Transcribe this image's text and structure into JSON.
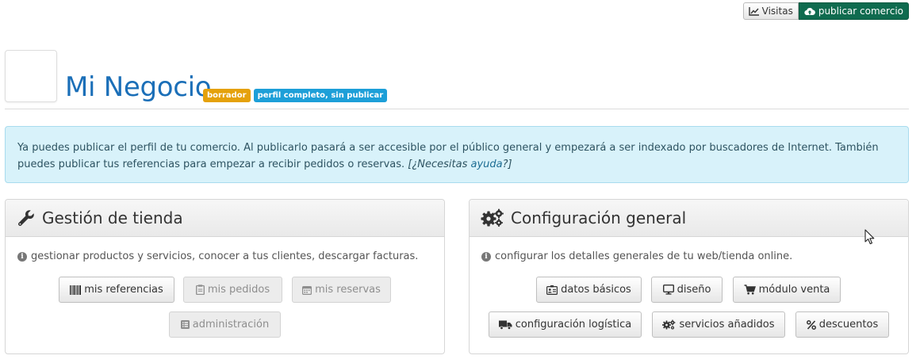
{
  "top_actions": {
    "visits_label": "Visitas",
    "publish_label": "publicar comercio",
    "publish_color": "#0f6b4f"
  },
  "header": {
    "title": "Mi Negocio",
    "badge_draft": "borrador",
    "badge_status": "perfil completo, sin publicar",
    "title_color": "#1b6fb8"
  },
  "alert": {
    "text": "Ya puedes publicar el perfil de tu comercio. Al publicarlo pasará a ser accesible por el público general y empezará a ser indexado por buscadores de Internet. También puedes publicar tus referencias para empezar a recibir pedidos o reservas. ",
    "help_prefix": "[¿Necesitas ",
    "help_link": "ayuda",
    "help_suffix": "?]"
  },
  "store_panel": {
    "title": "Gestión de tienda",
    "icon": "wrench-icon",
    "description": "gestionar productos y servicios, conocer a tus clientes, descargar facturas.",
    "buttons": {
      "references": "mis referencias",
      "orders": "mis pedidos",
      "bookings": "mis reservas",
      "admin": "administración"
    }
  },
  "config_panel": {
    "title": "Configuración general",
    "icon": "gears-icon",
    "description": "configurar los detalles generales de tu web/tienda online.",
    "buttons": {
      "basic_data": "datos básicos",
      "design": "diseño",
      "sales_module": "módulo venta",
      "logistics": "configuración logística",
      "added_services": "servicios añadidos",
      "discounts": "descuentos"
    }
  }
}
